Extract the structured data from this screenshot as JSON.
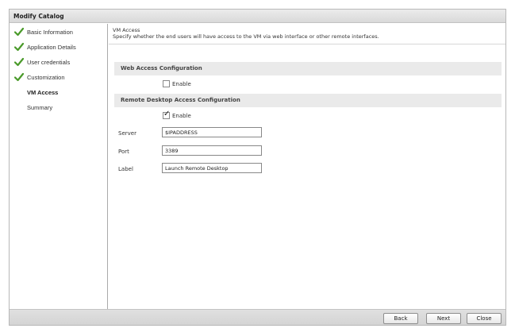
{
  "dialog": {
    "title": "Modify Catalog"
  },
  "sidebar": {
    "items": [
      {
        "label": "Basic Information",
        "done": true
      },
      {
        "label": "Application Details",
        "done": true
      },
      {
        "label": "User credentials",
        "done": true
      },
      {
        "label": "Customization",
        "done": true
      },
      {
        "label": "VM Access",
        "done": false,
        "active": true
      },
      {
        "label": "Summary",
        "done": false
      }
    ]
  },
  "content": {
    "title": "VM Access",
    "description": "Specify whether the end users will have access to the VM via web interface or other remote interfaces.",
    "web_access": {
      "heading": "Web Access Configuration",
      "enable_label": "Enable",
      "enabled": false
    },
    "remote_desktop": {
      "heading": "Remote Desktop Access Configuration",
      "enable_label": "Enable",
      "enabled": true,
      "fields": {
        "server_label": "Server",
        "server_value": "$IPADDRESS",
        "port_label": "Port",
        "port_value": "3389",
        "label_label": "Label",
        "label_value": "Launch Remote Desktop"
      }
    }
  },
  "footer": {
    "back": "Back",
    "next": "Next",
    "close": "Close"
  },
  "colors": {
    "check_green": "#4a9a2a",
    "section_bg": "#eaeaea"
  },
  "icons": {
    "completed": "check-icon",
    "checkbox_checked": "checkmark"
  }
}
